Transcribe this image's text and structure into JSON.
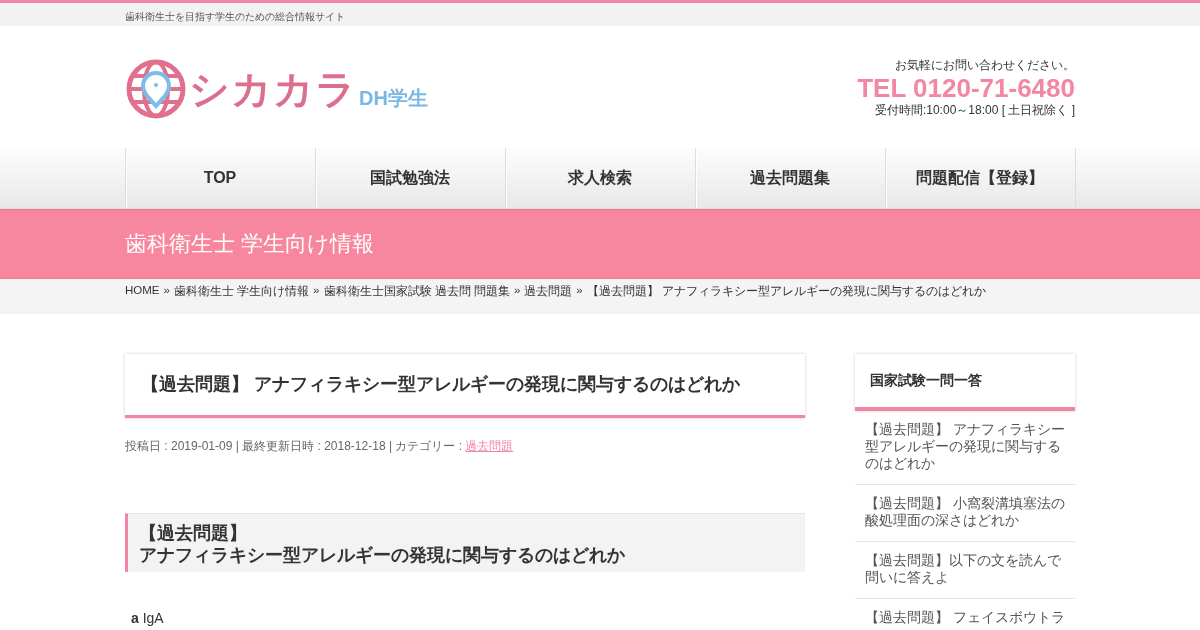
{
  "tagline": "歯科衛生士を目指す学生のための総合情報サイト",
  "logo": {
    "name": "シカカラ",
    "sub": "DH学生"
  },
  "contact": {
    "note": "お気軽にお問い合わせください。",
    "tel": "TEL 0120-71-6480",
    "hours": "受付時間:10:00～18:00 [ 土日祝除く ]"
  },
  "nav": [
    {
      "label": "TOP"
    },
    {
      "label": "国試勉強法"
    },
    {
      "label": "求人検索"
    },
    {
      "label": "過去問題集"
    },
    {
      "label": "問題配信【登録】"
    }
  ],
  "page_title": "歯科衛生士 学生向け情報",
  "breadcrumb_separator": "»",
  "breadcrumb": [
    "HOME",
    "歯科衛生士 学生向け情報",
    "歯科衛生士国家試験 過去問 問題集",
    "過去問題",
    "【過去問題】 アナフィラキシー型アレルギーの発現に関与するのはどれか"
  ],
  "article": {
    "title": "【過去問題】 アナフィラキシー型アレルギーの発現に関与するのはどれか",
    "meta": "投稿日 : 2019-01-09 | 最終更新日時 : 2018-12-18 | カテゴリー : ",
    "category": "過去問題",
    "heading": [
      "【過去問題】",
      "アナフィラキシー型アレルギーの発現に関与するのはどれか"
    ],
    "choices": [
      {
        "letter": "a",
        "text": "IgA"
      }
    ]
  },
  "sidebar": {
    "title": "国家試験一問一答",
    "items": [
      "【過去問題】 アナフィラキシー型アレルギーの発現に関与するのはどれか",
      "【過去問題】 小窩裂溝填塞法の酸処理面の深さはどれか",
      "【過去問題】以下の文を読んで問いに答えよ",
      "【過去問題】 フェイスボウトラ"
    ]
  }
}
